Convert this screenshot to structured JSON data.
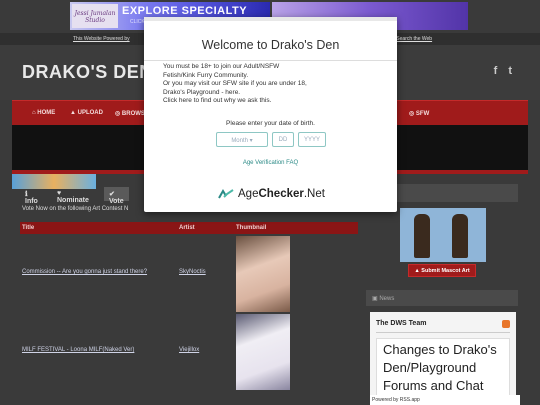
{
  "banner": {
    "brand": "Jessi Jumalan Studio",
    "headline": "EXPLORE SPECIALTY",
    "subline": "CLICK HERE"
  },
  "linkbar": {
    "powered": "This Website Powered by ",
    "links": "FTA Links · Search the Web"
  },
  "header": {
    "site_title": "DRAKO'S DEN",
    "social": [
      "f",
      "t"
    ]
  },
  "nav": {
    "items": [
      "HOME",
      "UPLOAD",
      "BROWSE",
      "SFW"
    ]
  },
  "main": {
    "tabs": [
      "Info",
      "Nominate",
      "Vote"
    ],
    "vote_line": "Vote Now on the following Art Contest N",
    "columns": [
      "Title",
      "Artist",
      "Thumbnail"
    ],
    "rows": [
      {
        "title": "Commission -- Are you gonna just stand there?",
        "artist": "SkyNoctis"
      },
      {
        "title": "MILF FESTIVAL - Loona MILF(Naked Ver)",
        "artist": "Viejillox"
      }
    ]
  },
  "sidebar": {
    "header1": "",
    "mascot_button": "Submit Mascot Art",
    "header2": "News",
    "feed_title": "The DWS Team",
    "feed_headline": "Changes to Drako's Den/Playground Forums and Chat",
    "powered_by": "Powered by RSS.app"
  },
  "modal": {
    "title": "Welcome to Drako's Den",
    "lines": [
      "You must be 18+ to join our Adult/NSFW",
      "Fetish/Kink Furry Community.",
      "Or you may visit our SFW site if you are under 18,",
      "Drako's Playground - here.",
      "Click here to find out why we ask this."
    ],
    "dob_label": "Please enter your date of birth.",
    "month_placeholder": "Month",
    "day_placeholder": "DD",
    "year_placeholder": "YYYY",
    "faq_link": "Age Verification FAQ",
    "brand_regular": "Age",
    "brand_bold": "Checker",
    "brand_suffix": ".Net"
  },
  "colors": {
    "accent_red": "#a01b1b",
    "teal": "#2b8a86",
    "background": "#3a3a3a"
  }
}
